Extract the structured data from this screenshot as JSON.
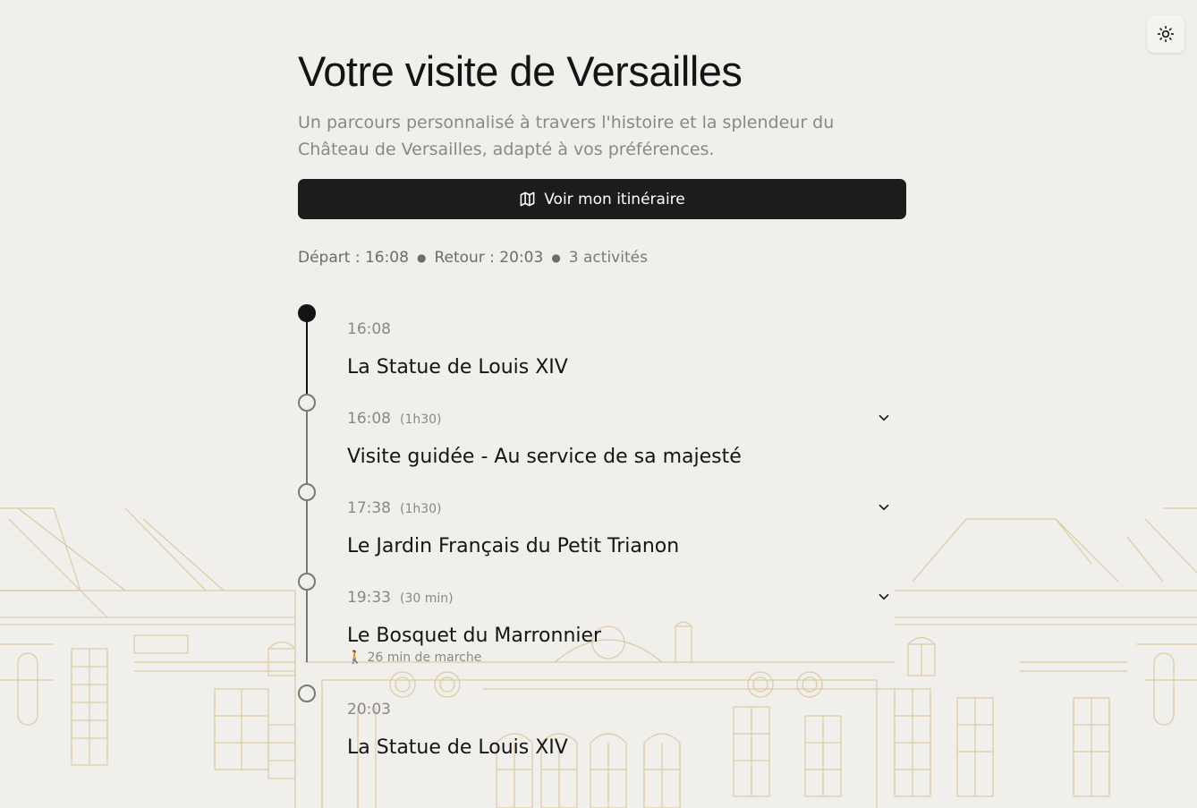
{
  "header": {
    "title": "Votre visite de Versailles",
    "subtitle": "Un parcours personnalisé à travers l'histoire et la splendeur du Château de Versailles, adapté à vos préférences.",
    "cta_label": "Voir mon itinéraire",
    "cta_icon": "map-icon",
    "theme_toggle_icon": "sun-icon"
  },
  "meta": {
    "departure": "Départ : 16:08",
    "return": "Retour : 20:03",
    "activities": "3 activités"
  },
  "timeline": [
    {
      "time": "16:08",
      "duration": "",
      "title": "La Statue de Louis XIV",
      "walk": ""
    },
    {
      "time": "16:08",
      "duration": "(1h30)",
      "title": "Visite guidée - Au service de sa majesté",
      "walk": ""
    },
    {
      "time": "17:38",
      "duration": "(1h30)",
      "title": "Le Jardin Français du Petit Trianon",
      "walk": ""
    },
    {
      "time": "19:33",
      "duration": "(30 min)",
      "title": "Le Bosquet du Marronnier",
      "walk": "26 min de marche"
    },
    {
      "time": "20:03",
      "duration": "",
      "title": "La Statue de Louis XIV",
      "walk": ""
    }
  ],
  "colors": {
    "background": "#f0efeb",
    "primary": "#1c1c1c",
    "muted_text": "#8a8884",
    "illustration_line": "#dccaa4"
  }
}
